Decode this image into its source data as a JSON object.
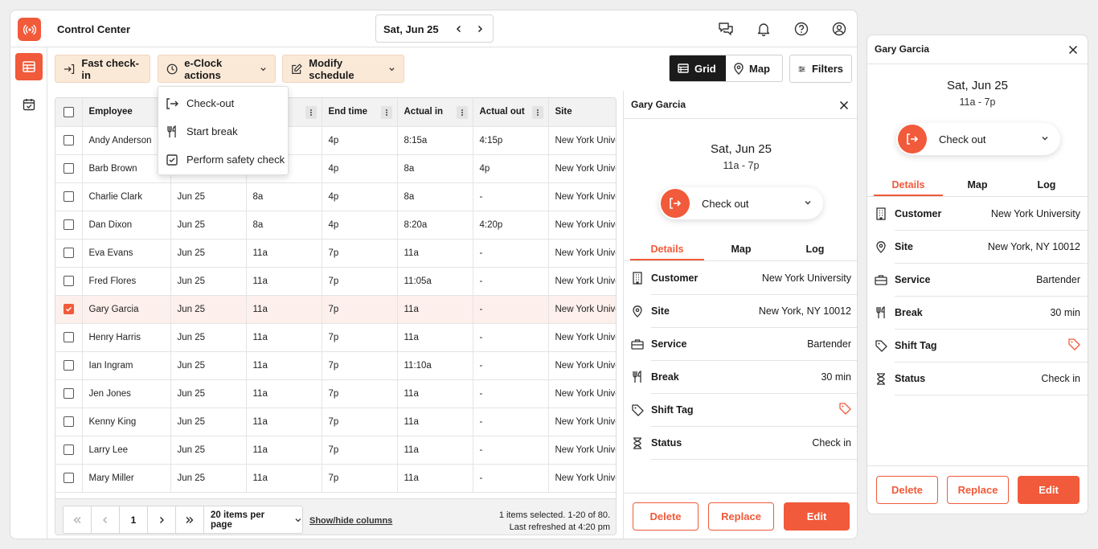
{
  "app": {
    "title": "Control Center"
  },
  "header": {
    "date": "Sat, Jun 25"
  },
  "toolbar": {
    "fast_checkin": "Fast check-in",
    "eclock": "e-Clock actions",
    "modify": "Modify schedule",
    "grid": "Grid",
    "map": "Map",
    "filters": "Filters"
  },
  "eclock_menu": [
    "Check-out",
    "Start break",
    "Perform safety check"
  ],
  "table": {
    "columns": [
      "Employee",
      "",
      "",
      "End time",
      "Actual in",
      "Actual out",
      "Site"
    ],
    "rows": [
      {
        "employee": "Andy Anderson",
        "date": "",
        "start": "",
        "end": "4p",
        "actual_in": "8:15a",
        "actual_out": "4:15p",
        "site": "New York University"
      },
      {
        "employee": "Barb Brown",
        "date": "",
        "start": "",
        "end": "4p",
        "actual_in": "8a",
        "actual_out": "4p",
        "site": "New York University"
      },
      {
        "employee": "Charlie Clark",
        "date": "Jun 25",
        "start": "8a",
        "end": "4p",
        "actual_in": "8a",
        "actual_out": "-",
        "site": "New York University"
      },
      {
        "employee": "Dan Dixon",
        "date": "Jun 25",
        "start": "8a",
        "end": "4p",
        "actual_in": "8:20a",
        "actual_out": "4:20p",
        "site": "New York University"
      },
      {
        "employee": "Eva Evans",
        "date": "Jun 25",
        "start": "11a",
        "end": "7p",
        "actual_in": "11a",
        "actual_out": "-",
        "site": "New York University"
      },
      {
        "employee": "Fred Flores",
        "date": "Jun 25",
        "start": "11a",
        "end": "7p",
        "actual_in": "11:05a",
        "actual_out": "-",
        "site": "New York University"
      },
      {
        "employee": "Gary Garcia",
        "date": "Jun 25",
        "start": "11a",
        "end": "7p",
        "actual_in": "11a",
        "actual_out": "-",
        "site": "New York University"
      },
      {
        "employee": "Henry Harris",
        "date": "Jun 25",
        "start": "11a",
        "end": "7p",
        "actual_in": "11a",
        "actual_out": "-",
        "site": "New York University"
      },
      {
        "employee": "Ian Ingram",
        "date": "Jun 25",
        "start": "11a",
        "end": "7p",
        "actual_in": "11:10a",
        "actual_out": "-",
        "site": "New York University"
      },
      {
        "employee": "Jen Jones",
        "date": "Jun 25",
        "start": "11a",
        "end": "7p",
        "actual_in": "11a",
        "actual_out": "-",
        "site": "New York University"
      },
      {
        "employee": "Kenny King",
        "date": "Jun 25",
        "start": "11a",
        "end": "7p",
        "actual_in": "11a",
        "actual_out": "-",
        "site": "New York University"
      },
      {
        "employee": "Larry Lee",
        "date": "Jun 25",
        "start": "11a",
        "end": "7p",
        "actual_in": "11a",
        "actual_out": "-",
        "site": "New York University"
      },
      {
        "employee": "Mary Miller",
        "date": "Jun 25",
        "start": "11a",
        "end": "7p",
        "actual_in": "11a",
        "actual_out": "-",
        "site": "New York University"
      }
    ],
    "selected_index": 6
  },
  "pager": {
    "page": "1",
    "per_page": "20 items per page",
    "show_hide": "Show/hide columns",
    "info_line1": "1 items selected. 1-20 of 80.",
    "info_line2": "Last refreshed at 4:20 pm"
  },
  "detail": {
    "name": "Gary Garcia",
    "date": "Sat, Jun 25",
    "time": "11a - 7p",
    "action": "Check out",
    "tabs": [
      "Details",
      "Map",
      "Log"
    ],
    "rows": [
      {
        "label": "Customer",
        "value": "New York University",
        "icon": "building-icon"
      },
      {
        "label": "Site",
        "value": "New York, NY 10012",
        "icon": "location-pin-icon"
      },
      {
        "label": "Service",
        "value": "Bartender",
        "icon": "briefcase-icon"
      },
      {
        "label": "Break",
        "value": "30 min",
        "icon": "utensils-icon"
      },
      {
        "label": "Shift Tag",
        "value": "",
        "icon": "tag-icon"
      },
      {
        "label": "Status",
        "value": "Check in",
        "icon": "hourglass-icon"
      }
    ],
    "buttons": {
      "delete": "Delete",
      "replace": "Replace",
      "edit": "Edit"
    }
  },
  "colors": {
    "accent": "#f15a3a",
    "toolbar_bg": "#fbe9d7",
    "selected_row": "#fdf0ec"
  }
}
